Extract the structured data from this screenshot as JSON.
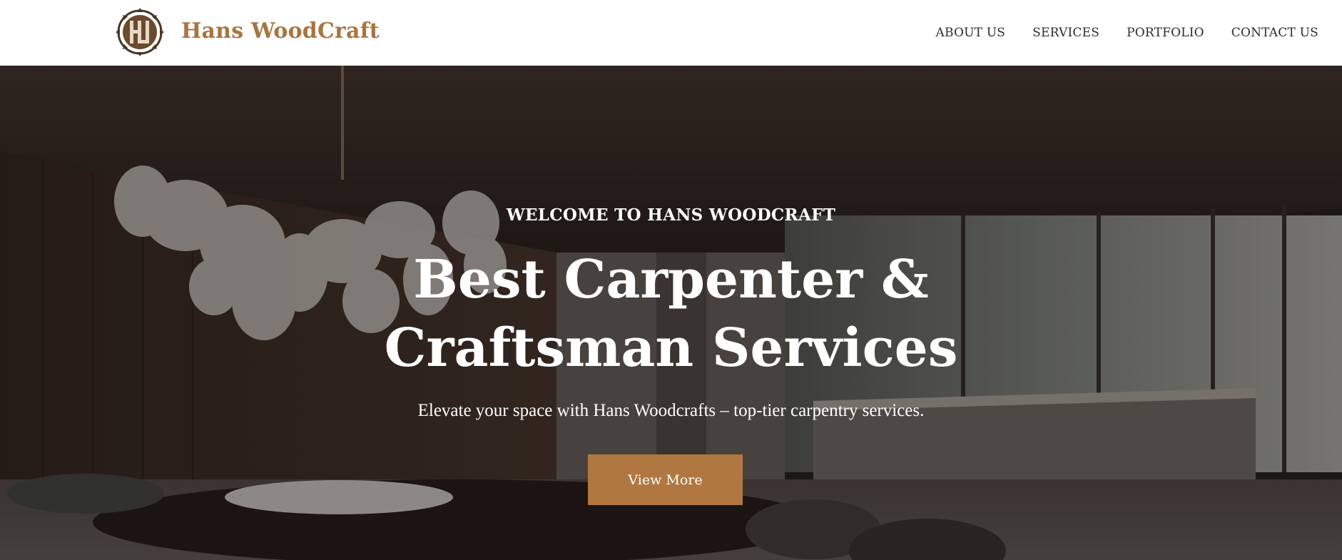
{
  "header": {
    "brand": "Hans WoodCraft",
    "logo_icon": "hw-saw-blade-logo-icon",
    "nav": [
      "ABOUT US",
      "SERVICES",
      "PORTFOLIO",
      "CONTACT US"
    ]
  },
  "hero": {
    "eyebrow": "WELCOME TO HANS WOODCRAFT",
    "headline_line1": "Best Carpenter &",
    "headline_line2": "Craftsman Services",
    "subtitle": "Elevate your space with Hans Woodcrafts – top-tier carpentry services.",
    "cta_label": "View More"
  },
  "colors": {
    "brand": "#a8743f",
    "cta_bg": "#b07840",
    "nav_text": "#2c2c2c",
    "hero_text": "#ffffff"
  }
}
